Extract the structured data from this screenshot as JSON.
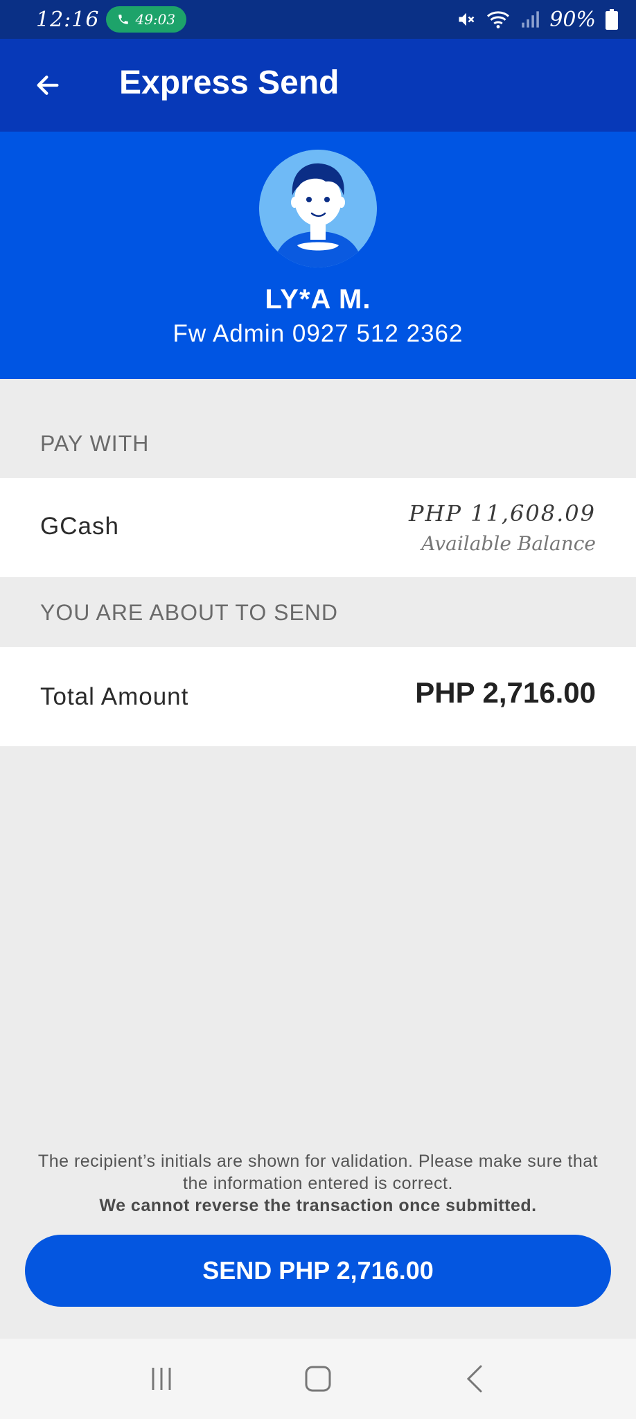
{
  "status_bar": {
    "time": "12:16",
    "call_duration": "49:03",
    "battery_percent": "90%"
  },
  "header": {
    "title": "Express Send"
  },
  "recipient": {
    "name": "LY*A M.",
    "subtitle": "Fw Admin 0927 512 2362"
  },
  "pay_with": {
    "label": "PAY WITH",
    "method": "GCash",
    "balance_amount": "PHP 11,608.09",
    "balance_label": "Available Balance"
  },
  "send_summary": {
    "label": "YOU ARE ABOUT TO SEND",
    "total_label": "Total Amount",
    "total_value": "PHP 2,716.00"
  },
  "disclaimer": {
    "text": "The recipient’s initials are shown for validation. Please make sure that the information entered is correct.",
    "bold_text": "We cannot reverse the transaction once submitted."
  },
  "action": {
    "send_label": "SEND PHP 2,716.00"
  },
  "colors": {
    "status_bar": "#0a3086",
    "app_bar": "#0739b8",
    "profile_bg": "#0055e3",
    "button": "#0456e0",
    "page_bg": "#ececec"
  }
}
